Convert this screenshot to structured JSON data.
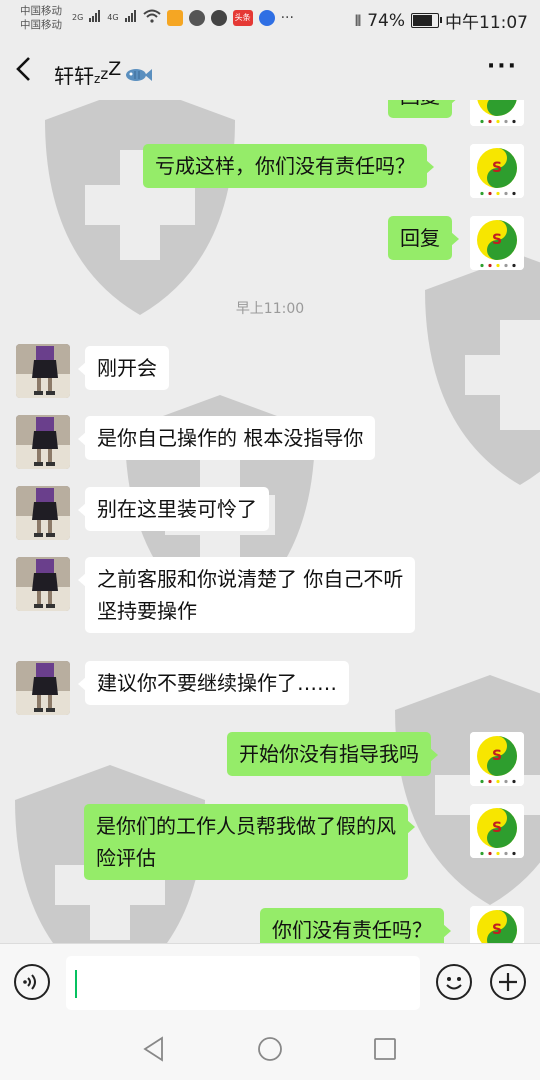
{
  "status_bar": {
    "carrier_1": "中国移动",
    "carrier_2": "中国移动",
    "net_1": "2G",
    "net_2": "4G",
    "app_badge": "头条",
    "more": "···",
    "battery_percent": "74%",
    "battery_level": 0.74,
    "time": "中午11:07"
  },
  "header": {
    "back_icon": "chevron-left-icon",
    "title": "轩轩",
    "title_decoration": "zzZ fish emoji",
    "more_icon": "more-dots-icon",
    "more_text": "···"
  },
  "messages": [
    {
      "side": "out",
      "text": "回复"
    },
    {
      "side": "out",
      "text": "亏成这样，你们没有责任吗？"
    },
    {
      "side": "out",
      "text": "回复"
    },
    {
      "side": "in",
      "text": "刚开会"
    },
    {
      "side": "in",
      "text": "是你自己操作的 根本没指导你"
    },
    {
      "side": "in",
      "text": "别在这里装可怜了"
    },
    {
      "side": "in",
      "text": "之前客服和你说清楚了 你自己不听\n坚持要操作"
    },
    {
      "side": "in",
      "text": "建议你不要继续操作了……"
    },
    {
      "side": "out",
      "text": "开始你没有指导我吗"
    },
    {
      "side": "out",
      "text": "是你们的工作人员帮我做了假的风\n险评估"
    },
    {
      "side": "out",
      "text": "你们没有责任吗？"
    }
  ],
  "timestamp": "早上11:00",
  "input_bar": {
    "voice_icon": "voice-icon",
    "emoji_icon": "emoji-icon",
    "plus_icon": "plus-icon",
    "input_value": ""
  },
  "nav_bar": {
    "back_icon": "triangle-back-icon",
    "home_icon": "circle-home-icon",
    "recents_icon": "square-recents-icon"
  },
  "colors": {
    "background": "#ededed",
    "outgoing_bubble": "#95ec69",
    "incoming_bubble": "#ffffff",
    "accent": "#07c160"
  }
}
